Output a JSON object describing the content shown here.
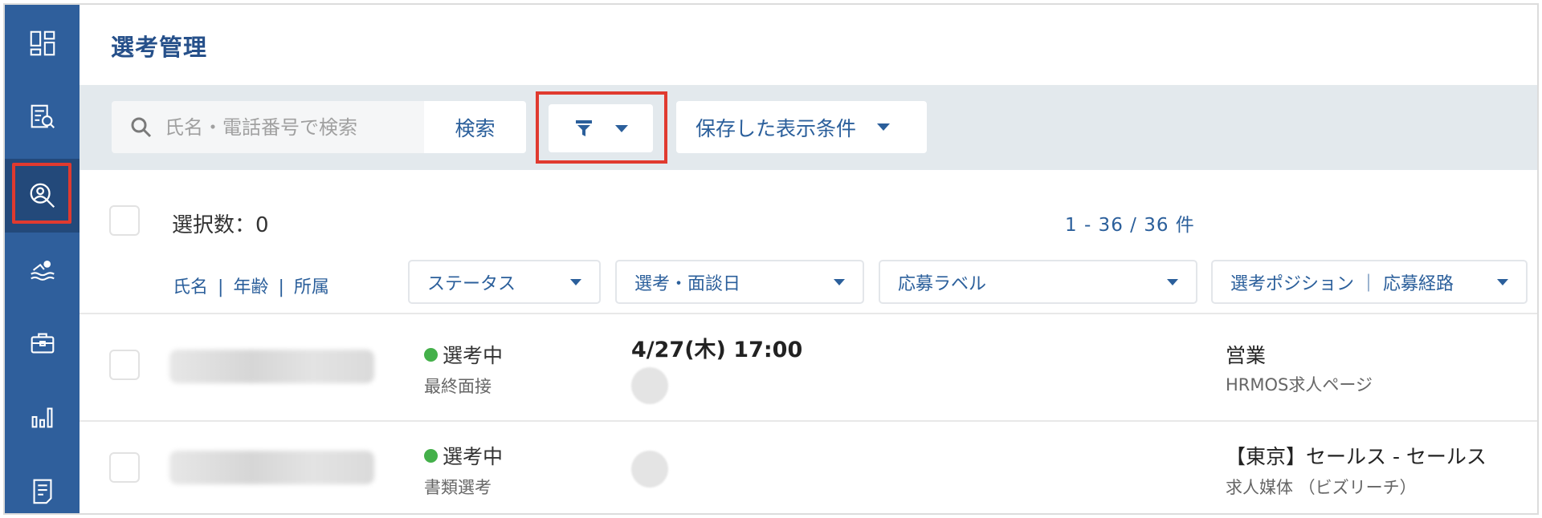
{
  "page": {
    "title": "選考管理"
  },
  "sidebar": {
    "items": [
      {
        "icon": "dashboard-icon"
      },
      {
        "icon": "document-search-icon"
      },
      {
        "icon": "candidate-search-icon",
        "active": true
      },
      {
        "icon": "swimmer-icon"
      },
      {
        "icon": "briefcase-icon"
      },
      {
        "icon": "bar-chart-icon"
      },
      {
        "icon": "document-list-icon"
      }
    ]
  },
  "toolbar": {
    "search_placeholder": "氏名・電話番号で検索",
    "search_button": "検索",
    "saved_conditions": "保存した表示条件"
  },
  "list": {
    "selected_label": "選択数：0",
    "pager": "1 - 36 / 36 件",
    "sort_links": [
      "氏名",
      "年齢",
      "所属"
    ],
    "filters": [
      "ステータス",
      "選考・面談日",
      "応募ラベル",
      "選考ポジション ｜ 応募経路"
    ]
  },
  "rows": [
    {
      "status": "選考中",
      "step": "最終面接",
      "date": "4/27(木) 17:00",
      "position": "営業",
      "route": "HRMOS求人ページ"
    },
    {
      "status": "選考中",
      "step": "書類選考",
      "date": "",
      "position": "【東京】セールス - セールス",
      "route": "求人媒体 （ビズリーチ）"
    }
  ],
  "colors": {
    "sidebar": "#2f5f9c",
    "accent": "#2b5f9b",
    "highlight": "#e03a2f",
    "status_dot": "#44b04a"
  }
}
